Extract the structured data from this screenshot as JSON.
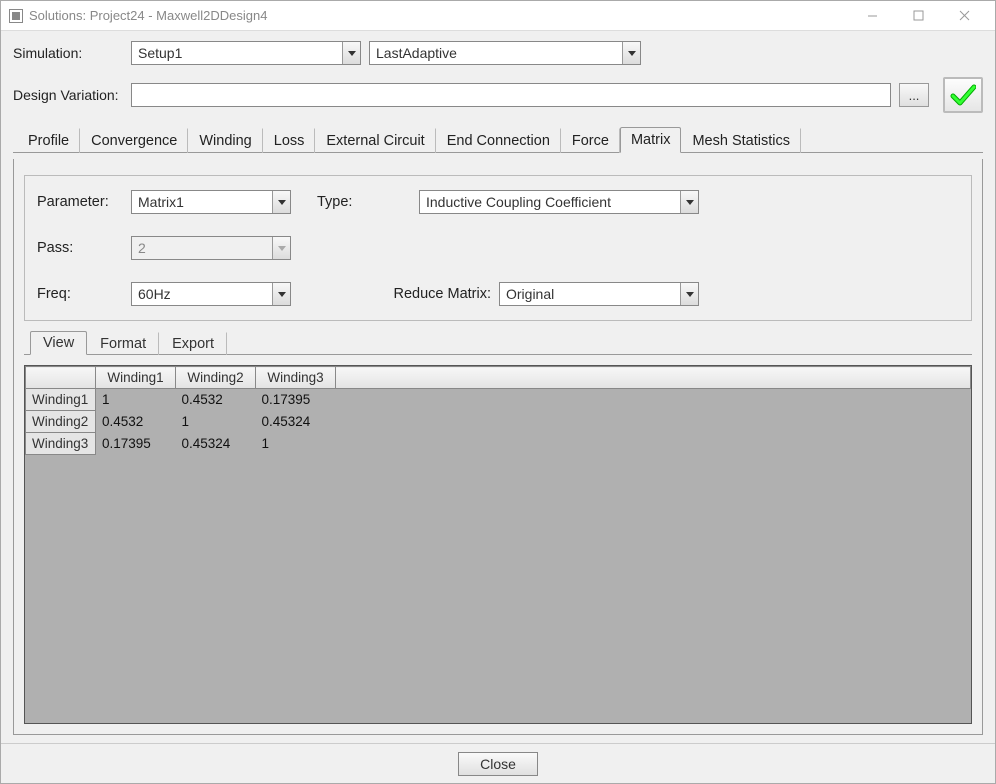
{
  "window": {
    "title": "Solutions: Project24 - Maxwell2DDesign4"
  },
  "top": {
    "simulation_label": "Simulation:",
    "simulation_value": "Setup1",
    "variation_value": "LastAdaptive",
    "design_variation_label": "Design Variation:",
    "design_variation_value": "",
    "ellipsis": "..."
  },
  "tabs": [
    "Profile",
    "Convergence",
    "Winding",
    "Loss",
    "External Circuit",
    "End Connection",
    "Force",
    "Matrix",
    "Mesh Statistics"
  ],
  "active_tab_index": 7,
  "matrix": {
    "parameter_label": "Parameter:",
    "parameter_value": "Matrix1",
    "type_label": "Type:",
    "type_value": "Inductive Coupling Coefficient",
    "pass_label": "Pass:",
    "pass_value": "2",
    "freq_label": "Freq:",
    "freq_value": "60Hz",
    "reduce_label": "Reduce Matrix:",
    "reduce_value": "Original"
  },
  "subtabs": [
    "View",
    "Format",
    "Export"
  ],
  "active_subtab_index": 0,
  "table": {
    "columns": [
      "Winding1",
      "Winding2",
      "Winding3"
    ],
    "rows": [
      {
        "name": "Winding1",
        "values": [
          "1",
          "0.4532",
          "0.17395"
        ]
      },
      {
        "name": "Winding2",
        "values": [
          "0.4532",
          "1",
          "0.45324"
        ]
      },
      {
        "name": "Winding3",
        "values": [
          "0.17395",
          "0.45324",
          "1"
        ]
      }
    ]
  },
  "footer": {
    "close": "Close"
  }
}
